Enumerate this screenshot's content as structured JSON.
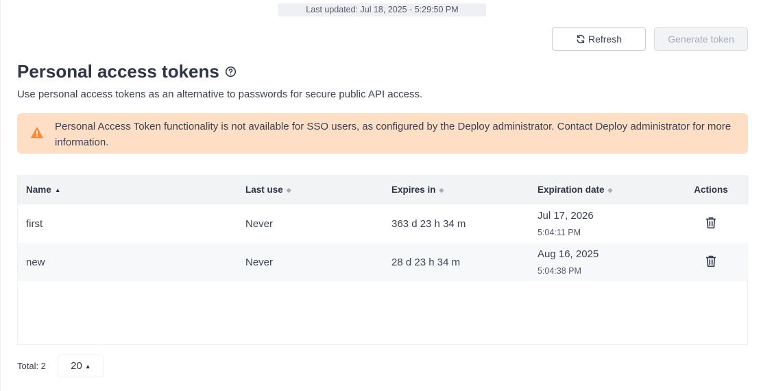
{
  "header": {
    "last_updated": "Last updated: Jul 18, 2025 - 5:29:50 PM"
  },
  "toolbar": {
    "refresh_label": "Refresh",
    "generate_label": "Generate token"
  },
  "page": {
    "title": "Personal access tokens",
    "subtitle": "Use personal access tokens as an alternative to passwords for secure public API access."
  },
  "alert": {
    "icon": "warning-icon",
    "color": "#fedfc6",
    "icon_color": "#f58b3c",
    "message": "Personal Access Token functionality is not available for SSO users, as configured by the Deploy administrator. Contact Deploy administrator for more information."
  },
  "table": {
    "columns": {
      "name": "Name",
      "last_use": "Last use",
      "expires_in": "Expires in",
      "expiration_date": "Expiration date",
      "actions": "Actions"
    },
    "sorted_column": "name",
    "sort_direction": "ascending",
    "rows": [
      {
        "name": "first",
        "last_use": "Never",
        "expires_in": "363 d 23 h 34 m",
        "expiration_date": "Jul 17, 2026",
        "expiration_time": "5:04:11 PM"
      },
      {
        "name": "new",
        "last_use": "Never",
        "expires_in": "28 d 23 h 34 m",
        "expiration_date": "Aug 16, 2025",
        "expiration_time": "5:04:38 PM"
      }
    ]
  },
  "footer": {
    "total": "Total: 2",
    "page_size": "20"
  }
}
